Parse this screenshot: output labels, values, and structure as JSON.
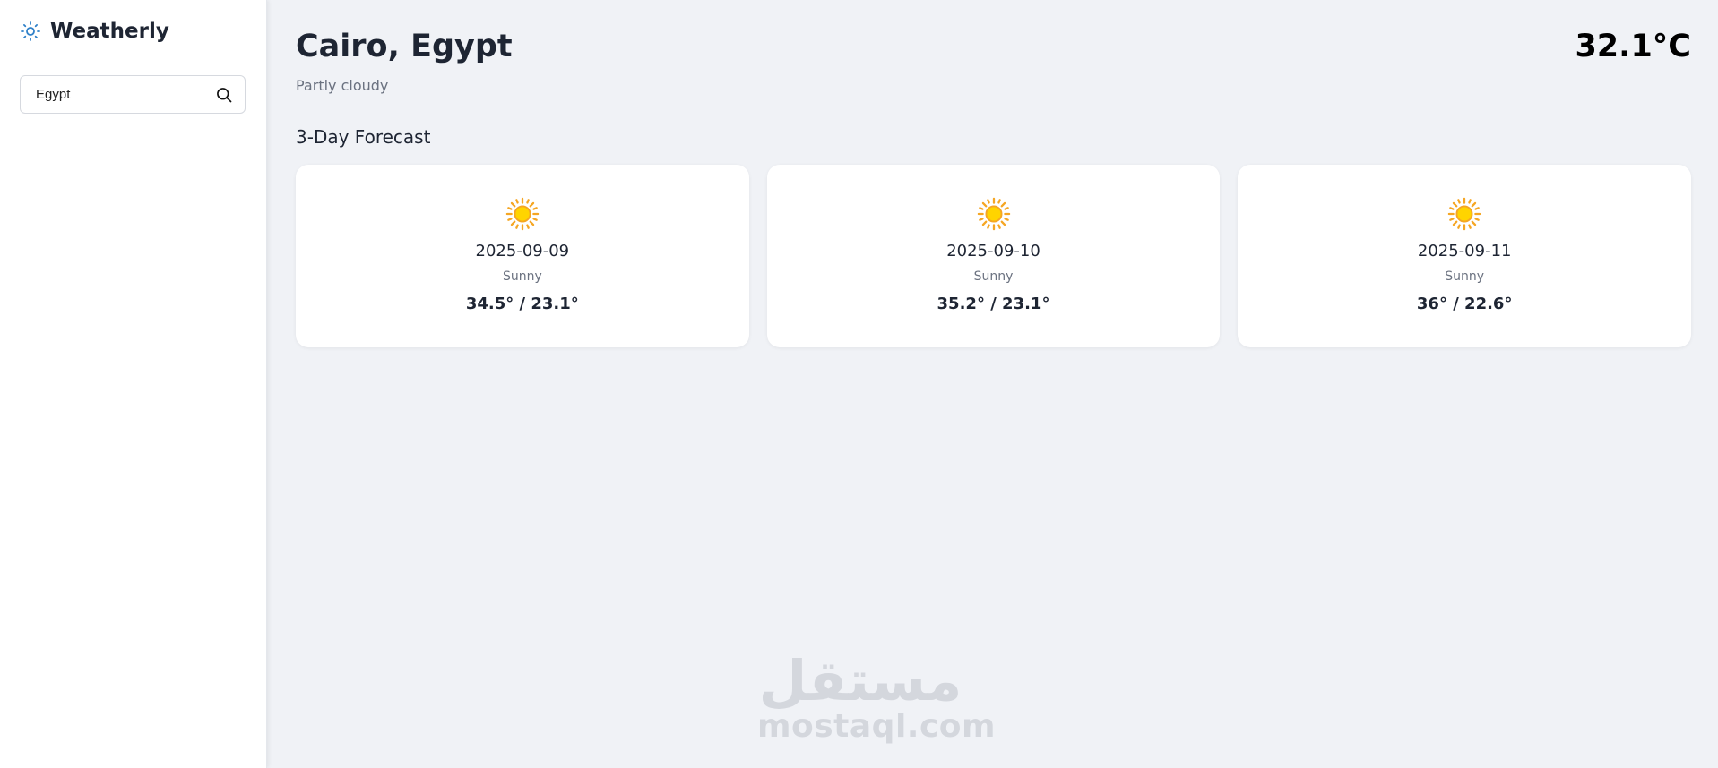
{
  "app": {
    "name": "Weatherly",
    "logo_icon": "sun-outline-icon",
    "accent_color": "#2f80c8"
  },
  "search": {
    "value": "Egypt",
    "icon": "search-icon"
  },
  "current": {
    "location": "Cairo, Egypt",
    "condition": "Partly cloudy",
    "temperature": "32.1°C"
  },
  "forecast": {
    "heading": "3-Day Forecast",
    "days": [
      {
        "date": "2025-09-09",
        "condition": "Sunny",
        "temps": "34.5° / 23.1°",
        "icon": "sun-icon"
      },
      {
        "date": "2025-09-10",
        "condition": "Sunny",
        "temps": "35.2° / 23.1°",
        "icon": "sun-icon"
      },
      {
        "date": "2025-09-11",
        "condition": "Sunny",
        "temps": "36° / 22.6°",
        "icon": "sun-icon"
      }
    ]
  },
  "watermark": {
    "arabic": "مستقل",
    "latin": "mostaql.com"
  }
}
